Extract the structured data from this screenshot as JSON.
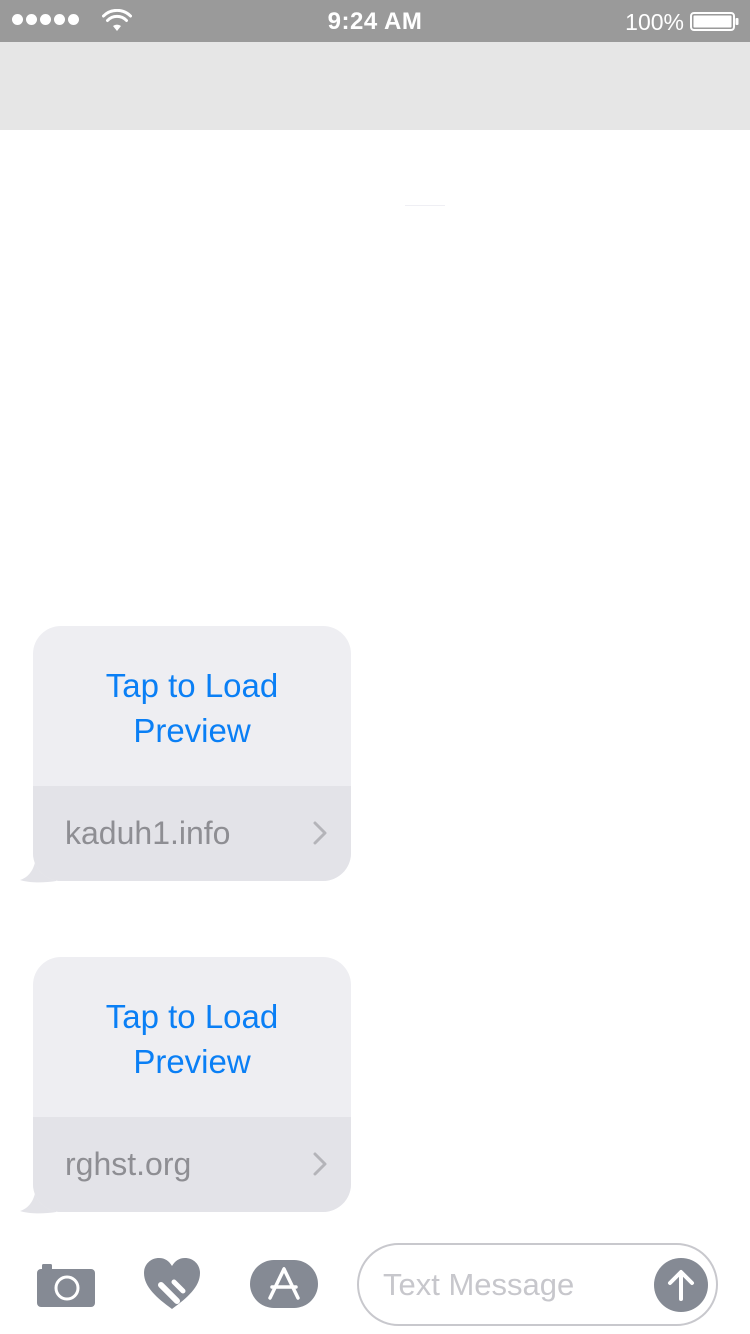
{
  "status_bar": {
    "time": "9:24 AM",
    "battery_percent": "100%",
    "signal_bars": 5,
    "battery_level": 1.0
  },
  "messages": [
    {
      "preview_text": "Tap to Load Preview",
      "domain": "kaduh1.info",
      "chevron_icon": "chevron-right-icon"
    },
    {
      "preview_text": "Tap to Load Preview",
      "domain": "rghst.org",
      "chevron_icon": "chevron-right-icon"
    }
  ],
  "composer": {
    "placeholder": "Text Message",
    "value": "",
    "icons": [
      "camera-icon",
      "digital-touch-icon",
      "app-store-icon",
      "send-arrow-icon"
    ]
  },
  "colors": {
    "status_bar_bg": "#9a9a9a",
    "nav_bar_bg": "#e6e6e6",
    "link_blue": "#0a7ff5",
    "bubble_bg": "#eeeef2",
    "link_row_bg": "#e3e3e8",
    "domain_gray": "#8e8e93",
    "icon_gray": "#858a94"
  }
}
